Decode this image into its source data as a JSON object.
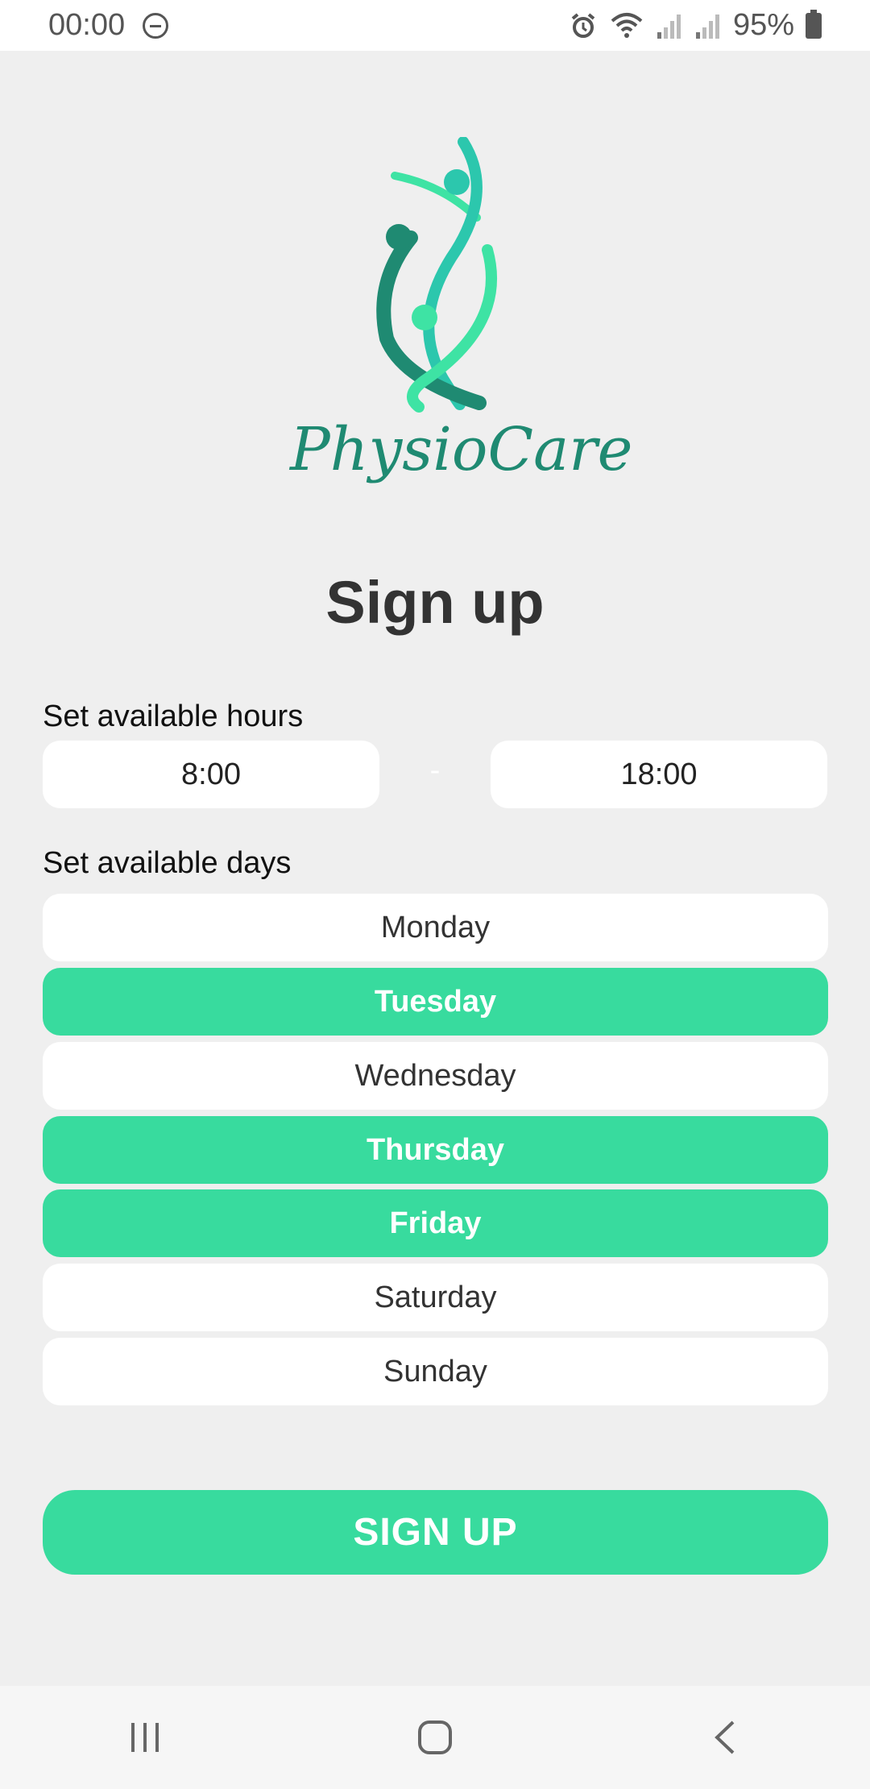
{
  "status_bar": {
    "time": "00:00",
    "battery": "95%",
    "icons": [
      "do-not-disturb-icon",
      "alarm-icon",
      "wifi-icon",
      "signal-icon",
      "signal-icon",
      "battery-icon"
    ]
  },
  "logo": {
    "text": "PhysioCare",
    "colors": {
      "teal_dark": "#1f8a72",
      "teal_mid": "#2cc7ad",
      "mint": "#3ee3a4"
    }
  },
  "page": {
    "title": "Sign up",
    "hours_label": "Set available hours",
    "start_time": "8:00",
    "separator": "-",
    "end_time": "18:00",
    "days_label": "Set available days",
    "days": [
      {
        "label": "Monday",
        "selected": false
      },
      {
        "label": "Tuesday",
        "selected": true
      },
      {
        "label": "Wednesday",
        "selected": false
      },
      {
        "label": "Thursday",
        "selected": true
      },
      {
        "label": "Friday",
        "selected": true
      },
      {
        "label": "Saturday",
        "selected": false
      },
      {
        "label": "Sunday",
        "selected": false
      }
    ],
    "submit_label": "SIGN UP"
  },
  "theme": {
    "accent": "#38db9e",
    "background": "#efefef",
    "field_bg": "#ffffff"
  },
  "nav_bar": {
    "icons": [
      "recent-apps-icon",
      "home-icon",
      "back-icon"
    ]
  }
}
